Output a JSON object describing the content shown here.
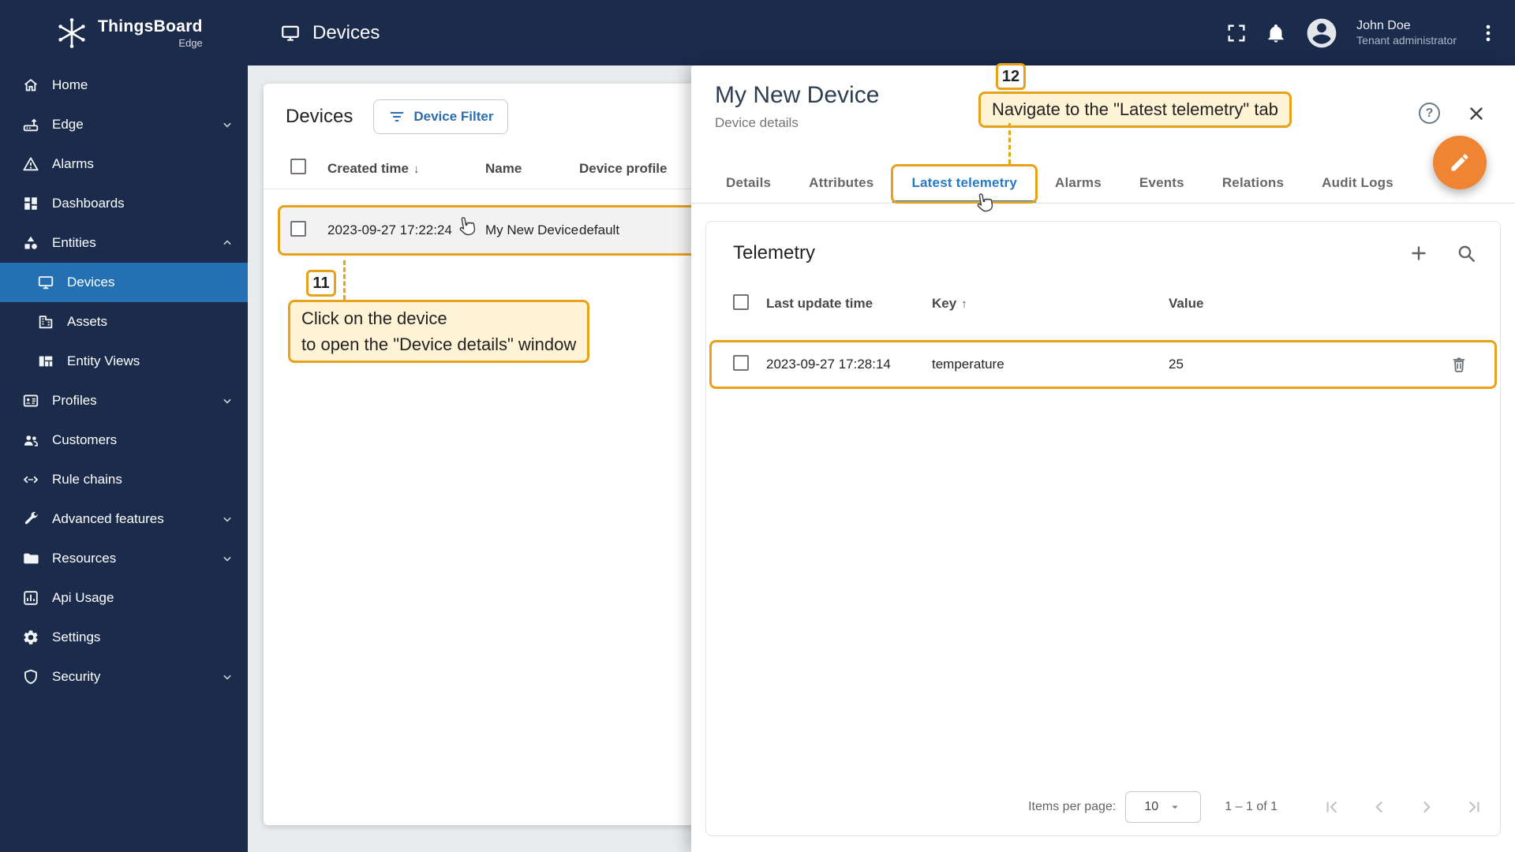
{
  "app": {
    "logo_title": "ThingsBoard",
    "logo_subtitle": "Edge"
  },
  "topbar": {
    "title": "Devices",
    "user_name": "John Doe",
    "user_role": "Tenant administrator",
    "icons": [
      "fullscreen-icon",
      "notifications-icon",
      "avatar-icon",
      "kebab-menu-icon"
    ]
  },
  "sidebar": {
    "items": [
      {
        "label": "Home",
        "icon": "home-icon"
      },
      {
        "label": "Edge",
        "icon": "edge-icon",
        "chevron": "down"
      },
      {
        "label": "Alarms",
        "icon": "alarms-icon"
      },
      {
        "label": "Dashboards",
        "icon": "dashboards-icon"
      },
      {
        "label": "Entities",
        "icon": "entities-icon",
        "chevron": "up",
        "expanded": true
      },
      {
        "label": "Devices",
        "icon": "devices-icon",
        "selected": true,
        "child": true
      },
      {
        "label": "Assets",
        "icon": "assets-icon",
        "child": true
      },
      {
        "label": "Entity Views",
        "icon": "entity-views-icon",
        "child": true
      },
      {
        "label": "Profiles",
        "icon": "profiles-icon",
        "chevron": "down"
      },
      {
        "label": "Customers",
        "icon": "customers-icon"
      },
      {
        "label": "Rule chains",
        "icon": "rule-chains-icon"
      },
      {
        "label": "Advanced features",
        "icon": "advanced-features-icon",
        "chevron": "down"
      },
      {
        "label": "Resources",
        "icon": "resources-icon",
        "chevron": "down"
      },
      {
        "label": "Api Usage",
        "icon": "api-usage-icon"
      },
      {
        "label": "Settings",
        "icon": "settings-icon"
      },
      {
        "label": "Security",
        "icon": "security-icon",
        "chevron": "down"
      }
    ]
  },
  "devices_panel": {
    "title": "Devices",
    "filter_button_label": "Device Filter",
    "columns": {
      "created_time": "Created time",
      "name": "Name",
      "profile": "Device profile"
    },
    "sort": {
      "column": "Created time",
      "direction": "desc",
      "arrow": "↓"
    },
    "row": {
      "created_time": "2023-09-27 17:22:24",
      "name": "My New Device",
      "profile": "default"
    }
  },
  "details_panel": {
    "title": "My New Device",
    "subtitle": "Device details",
    "help_label": "?",
    "tabs": [
      "Details",
      "Attributes",
      "Latest telemetry",
      "Alarms",
      "Events",
      "Relations",
      "Audit Logs"
    ],
    "active_tab": "Latest telemetry",
    "telemetry": {
      "title": "Telemetry",
      "columns": {
        "last_update_time": "Last update time",
        "key": "Key",
        "value": "Value"
      },
      "sort": {
        "column": "Key",
        "direction": "asc",
        "arrow": "↑"
      },
      "row": {
        "last_update_time": "2023-09-27 17:28:14",
        "key": "temperature",
        "value": "25"
      },
      "paginator": {
        "items_per_page_label": "Items per page:",
        "items_per_page": "10",
        "range": "1 – 1 of 1"
      }
    }
  },
  "annotations": {
    "step11": {
      "number": "11",
      "line1": "Click on the device",
      "line2": "to open the \"Device details\" window"
    },
    "step12": {
      "number": "12",
      "text": "Navigate to the \"Latest telemetry\" tab"
    }
  },
  "colors": {
    "sidebar_bg": "#1b2b4c",
    "selected_item_bg": "#2570b3",
    "active_tab_blue": "#2779c4",
    "annotation_orange": "#e8a21a",
    "annotation_bg": "#fff3d6",
    "fab_orange": "#ef8432"
  }
}
